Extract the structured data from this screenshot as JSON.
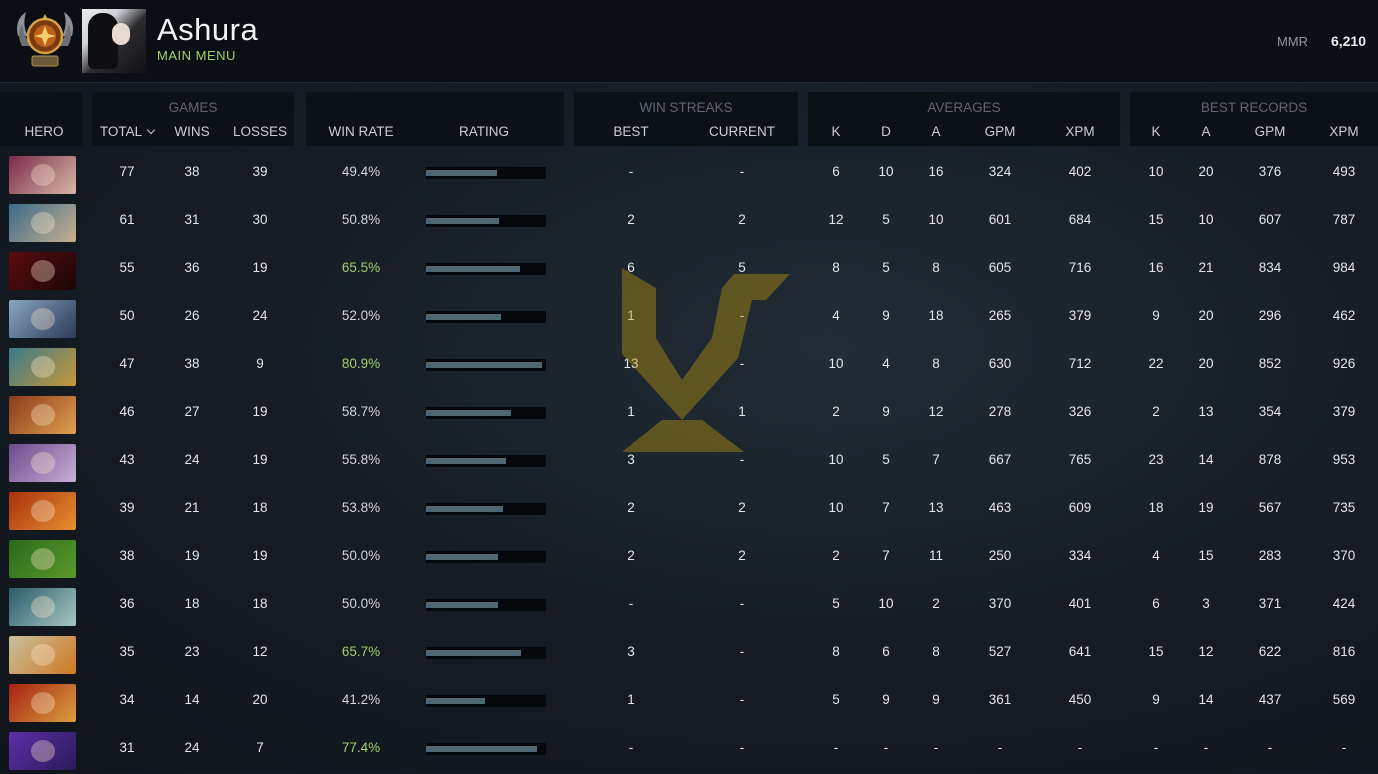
{
  "header": {
    "player_name": "Ashura",
    "subtitle": "MAIN MENU",
    "mmr_label": "MMR",
    "mmr_value": "6,210"
  },
  "group_titles": {
    "games": "GAMES",
    "win_streaks": "WIN STREAKS",
    "averages": "AVERAGES",
    "best_records": "BEST RECORDS"
  },
  "columns": {
    "hero": "HERO",
    "total": "TOTAL",
    "wins": "WINS",
    "losses": "LOSSES",
    "win_rate": "WIN RATE",
    "rating": "RATING",
    "streak_best": "BEST",
    "streak_current": "CURRENT",
    "avg_k": "K",
    "avg_d": "D",
    "avg_a": "A",
    "avg_gpm": "GPM",
    "avg_xpm": "XPM",
    "best_k": "K",
    "best_a": "A",
    "best_gpm": "GPM",
    "best_xpm": "XPM"
  },
  "colors": {
    "accent_green": "#9ed16a",
    "rating_bar": "#4f6673",
    "watermark": "#b8960c"
  },
  "rows": [
    {
      "hero_icon": "invoker-portrait",
      "hero_colors": [
        "#7a2a4a",
        "#d8b8a8"
      ],
      "total": "77",
      "wins": "38",
      "losses": "39",
      "win_rate": "49.4%",
      "win_rate_value": 0.494,
      "streak_best": "-",
      "streak_current": "-",
      "k": "6",
      "d": "10",
      "a": "16",
      "gpm": "324",
      "xpm": "402",
      "best_k": "10",
      "best_a": "20",
      "best_gpm": "376",
      "best_xpm": "493"
    },
    {
      "hero_icon": "sniper-portrait",
      "hero_colors": [
        "#3a6a8a",
        "#c8b090"
      ],
      "total": "61",
      "wins": "31",
      "losses": "30",
      "win_rate": "50.8%",
      "win_rate_value": 0.508,
      "streak_best": "2",
      "streak_current": "2",
      "k": "12",
      "d": "5",
      "a": "10",
      "gpm": "601",
      "xpm": "684",
      "best_k": "15",
      "best_a": "10",
      "best_gpm": "607",
      "best_xpm": "787"
    },
    {
      "hero_icon": "shadow-fiend-portrait",
      "hero_colors": [
        "#5a0c10",
        "#1a0608"
      ],
      "total": "55",
      "wins": "36",
      "losses": "19",
      "win_rate": "65.5%",
      "win_rate_value": 0.655,
      "streak_best": "6",
      "streak_current": "5",
      "k": "8",
      "d": "5",
      "a": "8",
      "gpm": "605",
      "xpm": "716",
      "best_k": "16",
      "best_a": "21",
      "best_gpm": "834",
      "best_xpm": "984"
    },
    {
      "hero_icon": "crystal-maiden-portrait",
      "hero_colors": [
        "#8aa6c0",
        "#2a3a58"
      ],
      "total": "50",
      "wins": "26",
      "losses": "24",
      "win_rate": "52.0%",
      "win_rate_value": 0.52,
      "streak_best": "1",
      "streak_current": "-",
      "k": "4",
      "d": "9",
      "a": "18",
      "gpm": "265",
      "xpm": "379",
      "best_k": "9",
      "best_a": "20",
      "best_gpm": "296",
      "best_xpm": "462"
    },
    {
      "hero_icon": "spirit-breaker-portrait",
      "hero_colors": [
        "#3a7a8a",
        "#c89838"
      ],
      "total": "47",
      "wins": "38",
      "losses": "9",
      "win_rate": "80.9%",
      "win_rate_value": 0.809,
      "streak_best": "13",
      "streak_current": "-",
      "k": "10",
      "d": "4",
      "a": "8",
      "gpm": "630",
      "xpm": "712",
      "best_k": "22",
      "best_a": "20",
      "best_gpm": "852",
      "best_xpm": "926"
    },
    {
      "hero_icon": "earthshaker-portrait",
      "hero_colors": [
        "#8a3a18",
        "#e0a050"
      ],
      "total": "46",
      "wins": "27",
      "losses": "19",
      "win_rate": "58.7%",
      "win_rate_value": 0.587,
      "streak_best": "1",
      "streak_current": "1",
      "k": "2",
      "d": "9",
      "a": "12",
      "gpm": "278",
      "xpm": "326",
      "best_k": "2",
      "best_a": "13",
      "best_gpm": "354",
      "best_xpm": "379"
    },
    {
      "hero_icon": "templar-assassin-portrait",
      "hero_colors": [
        "#6a4a8a",
        "#c8b0d8"
      ],
      "total": "43",
      "wins": "24",
      "losses": "19",
      "win_rate": "55.8%",
      "win_rate_value": 0.558,
      "streak_best": "3",
      "streak_current": "-",
      "k": "10",
      "d": "5",
      "a": "7",
      "gpm": "667",
      "xpm": "765",
      "best_k": "23",
      "best_a": "14",
      "best_gpm": "878",
      "best_xpm": "953"
    },
    {
      "hero_icon": "ember-spirit-portrait",
      "hero_colors": [
        "#a8300c",
        "#e89030"
      ],
      "total": "39",
      "wins": "21",
      "losses": "18",
      "win_rate": "53.8%",
      "win_rate_value": 0.538,
      "streak_best": "2",
      "streak_current": "2",
      "k": "10",
      "d": "7",
      "a": "13",
      "gpm": "463",
      "xpm": "609",
      "best_k": "18",
      "best_a": "19",
      "best_gpm": "567",
      "best_xpm": "735"
    },
    {
      "hero_icon": "rubick-portrait",
      "hero_colors": [
        "#2a6a1a",
        "#5a9a2a"
      ],
      "total": "38",
      "wins": "19",
      "losses": "19",
      "win_rate": "50.0%",
      "win_rate_value": 0.5,
      "streak_best": "2",
      "streak_current": "2",
      "k": "2",
      "d": "7",
      "a": "11",
      "gpm": "250",
      "xpm": "334",
      "best_k": "4",
      "best_a": "15",
      "best_gpm": "283",
      "best_xpm": "370"
    },
    {
      "hero_icon": "tinker-portrait",
      "hero_colors": [
        "#2a5a6a",
        "#a8c8c0"
      ],
      "total": "36",
      "wins": "18",
      "losses": "18",
      "win_rate": "50.0%",
      "win_rate_value": 0.5,
      "streak_best": "-",
      "streak_current": "-",
      "k": "5",
      "d": "10",
      "a": "2",
      "gpm": "370",
      "xpm": "401",
      "best_k": "6",
      "best_a": "3",
      "best_gpm": "371",
      "best_xpm": "424"
    },
    {
      "hero_icon": "keeper-of-the-light-portrait",
      "hero_colors": [
        "#c8c0a0",
        "#d07820"
      ],
      "total": "35",
      "wins": "23",
      "losses": "12",
      "win_rate": "65.7%",
      "win_rate_value": 0.657,
      "streak_best": "3",
      "streak_current": "-",
      "k": "8",
      "d": "6",
      "a": "8",
      "gpm": "527",
      "xpm": "641",
      "best_k": "15",
      "best_a": "12",
      "best_gpm": "622",
      "best_xpm": "816"
    },
    {
      "hero_icon": "legion-commander-portrait",
      "hero_colors": [
        "#a82010",
        "#d8a040"
      ],
      "total": "34",
      "wins": "14",
      "losses": "20",
      "win_rate": "41.2%",
      "win_rate_value": 0.412,
      "streak_best": "1",
      "streak_current": "-",
      "k": "5",
      "d": "9",
      "a": "9",
      "gpm": "361",
      "xpm": "450",
      "best_k": "9",
      "best_a": "14",
      "best_gpm": "437",
      "best_xpm": "569"
    },
    {
      "hero_icon": "void-spirit-portrait",
      "hero_colors": [
        "#5a30a8",
        "#2a1a58"
      ],
      "total": "31",
      "wins": "24",
      "losses": "7",
      "win_rate": "77.4%",
      "win_rate_value": 0.774,
      "streak_best": "-",
      "streak_current": "-",
      "k": "-",
      "d": "-",
      "a": "-",
      "gpm": "-",
      "xpm": "-",
      "best_k": "-",
      "best_a": "-",
      "best_gpm": "-",
      "best_xpm": "-"
    }
  ]
}
